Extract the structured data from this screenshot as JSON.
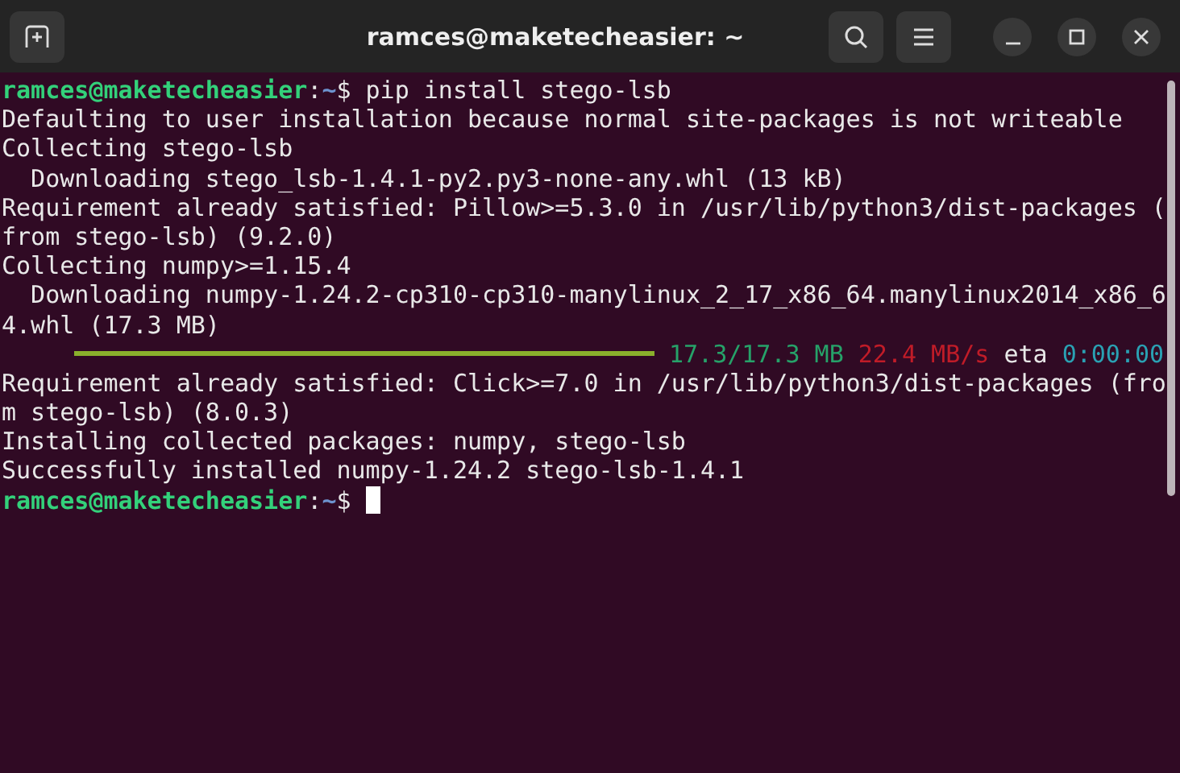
{
  "window": {
    "title": "ramces@maketecheasier: ~"
  },
  "terminal": {
    "cursor_visible": true,
    "lines": [
      {
        "kind": "prompt",
        "user": "ramces@maketecheasier",
        "separator": ":",
        "path": "~",
        "symbol": "$",
        "command": "pip install stego-lsb"
      },
      {
        "kind": "text",
        "text": "Defaulting to user installation because normal site-packages is not writeable"
      },
      {
        "kind": "text",
        "text": "Collecting stego-lsb"
      },
      {
        "kind": "text",
        "text": "  Downloading stego_lsb-1.4.1-py2.py3-none-any.whl (13 kB)"
      },
      {
        "kind": "text",
        "text": "Requirement already satisfied: Pillow>=5.3.0 in /usr/lib/python3/dist-packages ("
      },
      {
        "kind": "text",
        "text": "from stego-lsb) (9.2.0)"
      },
      {
        "kind": "text",
        "text": "Collecting numpy>=1.15.4"
      },
      {
        "kind": "text",
        "text": "  Downloading numpy-1.24.2-cp310-cp310-manylinux_2_17_x86_64.manylinux2014_x86_6"
      },
      {
        "kind": "text",
        "text": "4.whl (17.3 MB)"
      },
      {
        "kind": "progress",
        "level": 1,
        "size": "17.3/17.3 MB",
        "speed": "22.4 MB/s",
        "eta_label": "eta",
        "eta": "0:00:00"
      },
      {
        "kind": "text",
        "text": "Requirement already satisfied: Click>=7.0 in /usr/lib/python3/dist-packages (fro"
      },
      {
        "kind": "text",
        "text": "m stego-lsb) (8.0.3)"
      },
      {
        "kind": "text",
        "text": "Installing collected packages: numpy, stego-lsb"
      },
      {
        "kind": "text",
        "text": "Successfully installed numpy-1.24.2 stego-lsb-1.4.1"
      },
      {
        "kind": "prompt",
        "user": "ramces@maketecheasier",
        "separator": ":",
        "path": "~",
        "symbol": "$"
      }
    ]
  }
}
